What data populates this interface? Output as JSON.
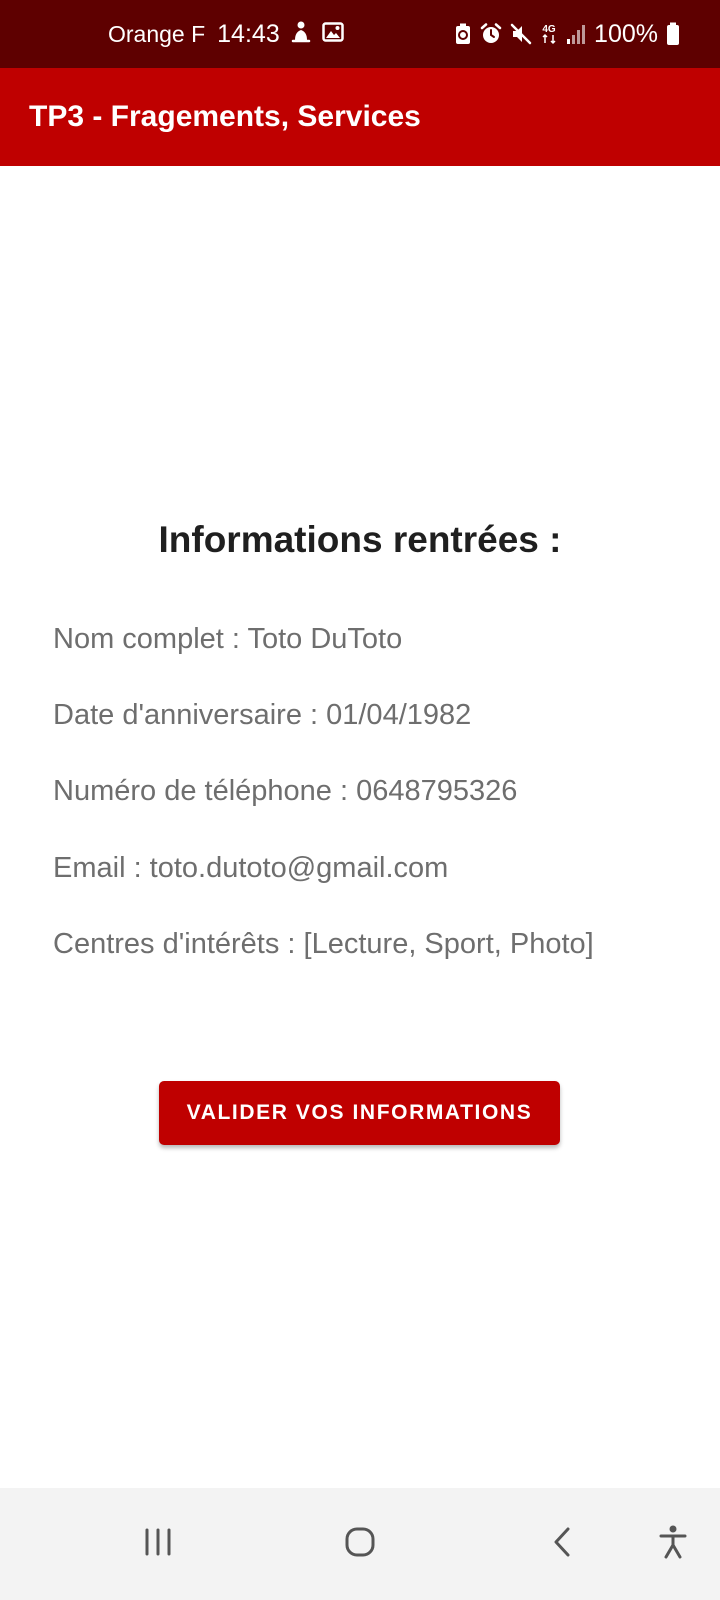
{
  "status_bar": {
    "carrier": "Orange F",
    "time": "14:43",
    "network": "4G",
    "battery": "100%"
  },
  "app_bar": {
    "title": "TP3 - Fragements, Services"
  },
  "info": {
    "heading": "Informations rentrées :",
    "lines": [
      "Nom complet : Toto DuToto",
      "Date d'anniversaire : 01/04/1982",
      "Numéro de téléphone : 0648795326",
      "Email : toto.dutoto@gmail.com",
      "Centres d'intérêts : [Lecture, Sport, Photo]"
    ]
  },
  "actions": {
    "validate_label": "VALIDER VOS INFORMATIONS"
  },
  "colors": {
    "status_bar": "#5e0000",
    "app_bar": "#bf0000",
    "button": "#bf0000",
    "nav_bar": "#f3f3f3"
  },
  "icons": {
    "status_left": [
      "notification-icon",
      "gallery-icon"
    ],
    "status_right": [
      "battery-saver-icon",
      "alarm-icon",
      "mute-icon",
      "network-4g-icon",
      "signal-icon",
      "battery-icon"
    ],
    "nav": [
      "recent-apps-icon",
      "home-icon",
      "back-icon",
      "accessibility-icon"
    ]
  }
}
